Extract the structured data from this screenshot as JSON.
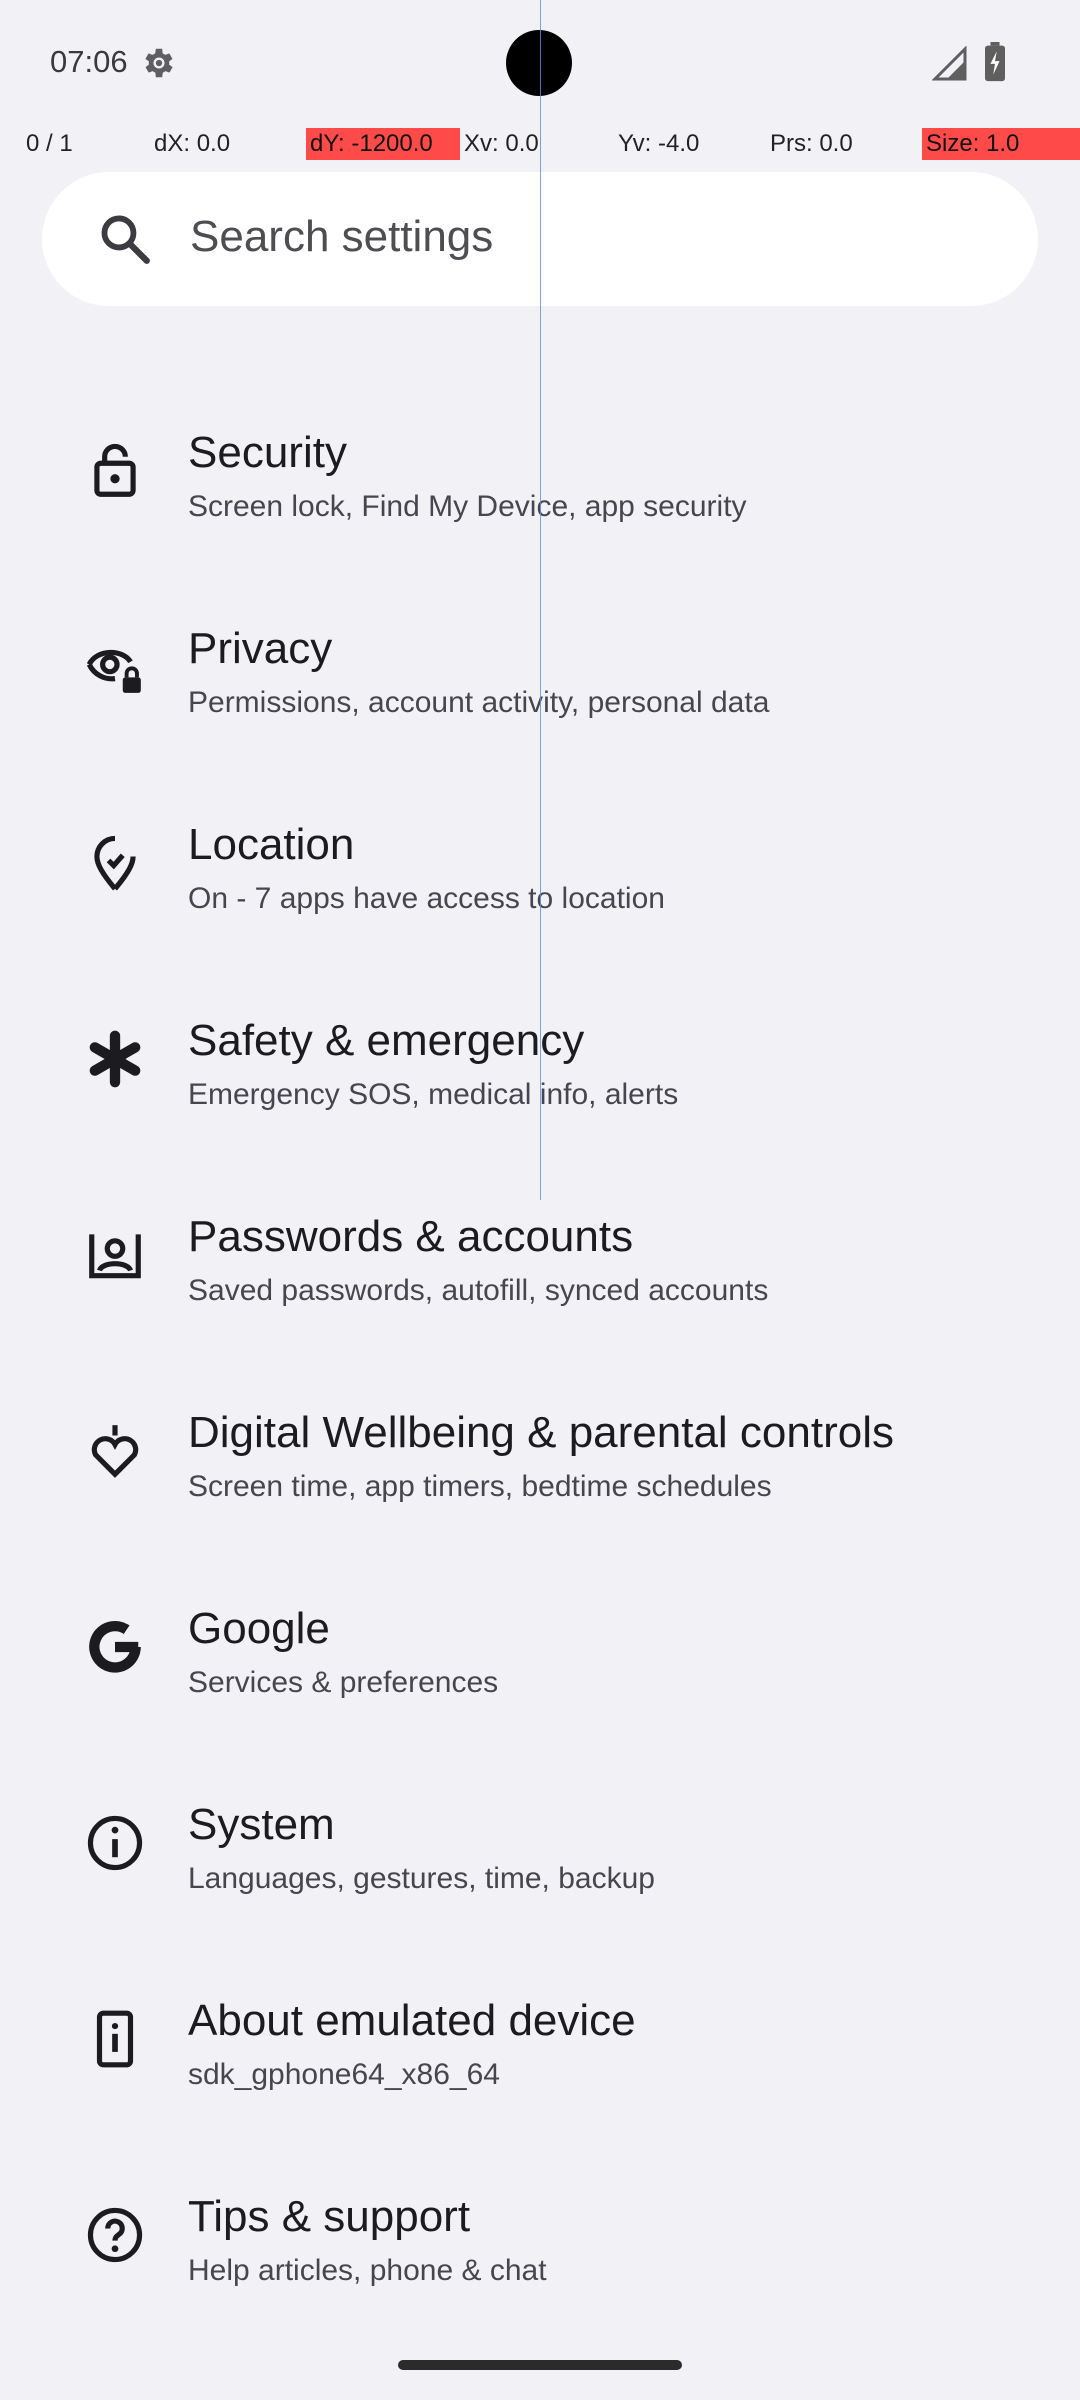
{
  "status_bar": {
    "time": "07:06",
    "settings_icon": "gear-icon",
    "signal_icon": "cell-signal-icon",
    "battery_icon": "battery-charging-icon"
  },
  "debug_overlay": {
    "pointer": "0 / 1",
    "dx": "dX: 0.0",
    "dy": "dY: -1200.0",
    "xv": "Xv: 0.0",
    "yv": "Yv: -4.0",
    "prs": "Prs: 0.0",
    "size": "Size: 1.0",
    "highlight_color": "#ff4a4a"
  },
  "search": {
    "placeholder": "Search settings",
    "icon": "search-icon"
  },
  "settings_list": [
    {
      "title": "Security",
      "subtitle": "Screen lock, Find My Device, app security",
      "icon": "lock-icon"
    },
    {
      "title": "Privacy",
      "subtitle": "Permissions, account activity, personal data",
      "icon": "eye-lock-icon"
    },
    {
      "title": "Location",
      "subtitle": "On - 7 apps have access to location",
      "icon": "location-pin-icon"
    },
    {
      "title": "Safety & emergency",
      "subtitle": "Emergency SOS, medical info, alerts",
      "icon": "medical-asterisk-icon"
    },
    {
      "title": "Passwords & accounts",
      "subtitle": "Saved passwords, autofill, synced accounts",
      "icon": "account-box-icon"
    },
    {
      "title": "Digital Wellbeing & parental controls",
      "subtitle": "Screen time, app timers, bedtime schedules",
      "icon": "heart-wellbeing-icon"
    },
    {
      "title": "Google",
      "subtitle": "Services & preferences",
      "icon": "google-g-icon"
    },
    {
      "title": "System",
      "subtitle": "Languages, gestures, time, backup",
      "icon": "info-circle-icon"
    },
    {
      "title": "About emulated device",
      "subtitle": "sdk_gphone64_x86_64",
      "icon": "device-info-icon"
    },
    {
      "title": "Tips & support",
      "subtitle": "Help articles, phone & chat",
      "icon": "help-circle-icon"
    }
  ],
  "colors": {
    "background": "#f2f1f6",
    "search_background": "#ffffff",
    "title_text": "#1c1b1f",
    "subtitle_text": "#47464f"
  }
}
